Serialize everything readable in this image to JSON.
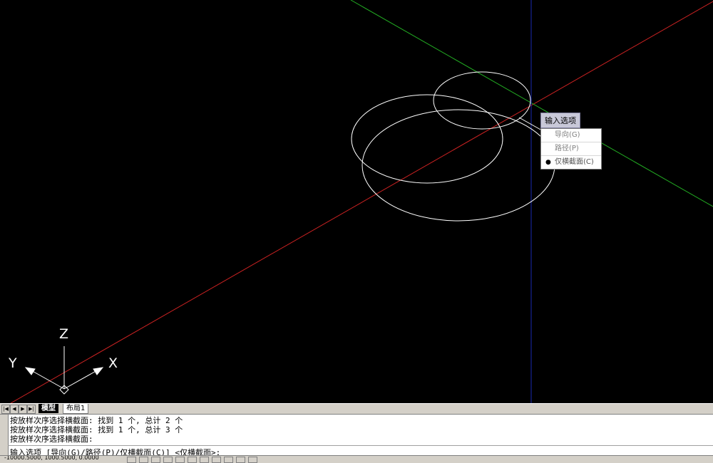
{
  "colors": {
    "viewport_bg": "#000000",
    "x_axis_line": "#cc2222",
    "y_axis_line": "#22aa22",
    "z_axis_line": "#1a2ab0",
    "geometry": "#ffffff"
  },
  "ucs_icon": {
    "x_label": "X",
    "y_label": "Y",
    "z_label": "Z"
  },
  "context_menu": {
    "header": "输入选项",
    "items": [
      {
        "label": "导向(G)",
        "selected": false
      },
      {
        "label": "路径(P)",
        "selected": false
      },
      {
        "label": "仅横截面(C)",
        "selected": true
      }
    ],
    "bullet": "●"
  },
  "layout_tabs": {
    "nav": [
      "|◀",
      "◀",
      "▶",
      "▶|"
    ],
    "tabs": [
      "模型",
      "布局1"
    ]
  },
  "command_window": {
    "history": [
      "按放样次序选择横截面: 找到 1 个, 总计 2 个",
      "按放样次序选择横截面: 找到 1 个, 总计 3 个",
      "按放样次序选择横截面:"
    ],
    "prompt": "输入选项 [导向(G)/路径(P)/仅横截面(C)] <仅横截面>:"
  },
  "status_bar": {
    "coordinates": "-10000.5000, 1000.5000, 0.0000"
  }
}
